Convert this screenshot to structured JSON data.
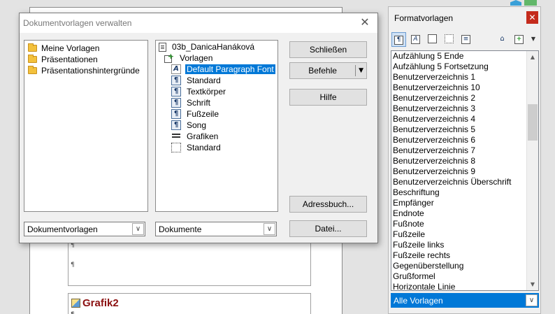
{
  "document": {
    "paragraph_mark": "¶",
    "graphic_label": "Grafik2"
  },
  "dialog": {
    "title": "Dokumentvorlagen verwalten",
    "close_glyph": "✕",
    "categories": [
      {
        "label": "Meine Vorlagen",
        "icon": "folder-icon"
      },
      {
        "label": "Präsentationen",
        "icon": "folder-icon"
      },
      {
        "label": "Präsentationshintergründe",
        "icon": "folder-icon"
      }
    ],
    "tree": {
      "document_name": "03b_DanicaHanáková",
      "templates_node": "Vorlagen",
      "styles": [
        {
          "label": "Default Paragraph Font",
          "kind": "char",
          "selected": true
        },
        {
          "label": "Standard",
          "kind": "para"
        },
        {
          "label": "Textkörper",
          "kind": "para"
        },
        {
          "label": "Schrift",
          "kind": "para"
        },
        {
          "label": "Fußzeile",
          "kind": "para"
        },
        {
          "label": "Song",
          "kind": "para"
        },
        {
          "label": "Grafiken",
          "kind": "frame"
        },
        {
          "label": "Standard",
          "kind": "page"
        }
      ]
    },
    "buttons": {
      "close": "Schließen",
      "commands": "Befehle",
      "help": "Hilfe",
      "address_book": "Adressbuch...",
      "file": "Datei..."
    },
    "combo_left": "Dokumentvorlagen",
    "combo_right": "Dokumente"
  },
  "panel": {
    "title": "Formatvorlagen",
    "close_glyph": "✕",
    "toolbar": {
      "paragraph_icon": "paragraph-styles-icon",
      "character_icon": "character-styles-icon",
      "frame_icon": "frame-styles-icon",
      "page_icon": "page-styles-icon",
      "list_icon": "list-styles-icon",
      "fill_icon": "fill-format-icon",
      "new_icon": "new-style-icon"
    },
    "styles": [
      "Aufzählung 5 Ende",
      "Aufzählung 5 Fortsetzung",
      "Benutzerverzeichnis 1",
      "Benutzerverzeichnis 10",
      "Benutzerverzeichnis 2",
      "Benutzerverzeichnis 3",
      "Benutzerverzeichnis 4",
      "Benutzerverzeichnis 5",
      "Benutzerverzeichnis 6",
      "Benutzerverzeichnis 7",
      "Benutzerverzeichnis 8",
      "Benutzerverzeichnis 9",
      "Benutzerverzeichnis Überschrift",
      "Beschriftung",
      "Empfänger",
      "Endnote",
      "Fußnote",
      "Fußzeile",
      "Fußzeile links",
      "Fußzeile rechts",
      "Gegenüberstellung",
      "Grußformel",
      "Horizontale Linie"
    ],
    "filter": "Alle Vorlagen"
  },
  "colors": {
    "selection": "#0078d7",
    "close_red": "#c42b1c",
    "graphic_label": "#8b1010"
  }
}
